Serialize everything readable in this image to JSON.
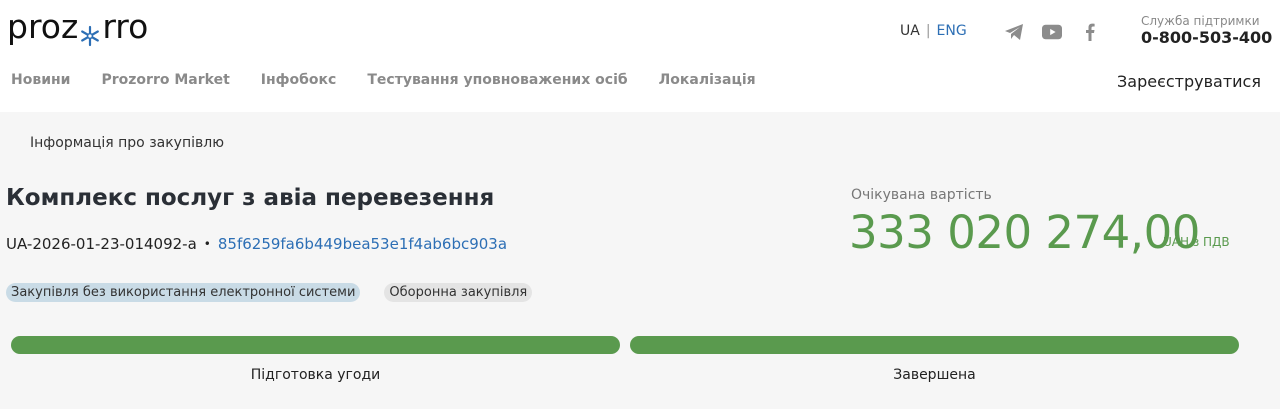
{
  "header": {
    "logo": {
      "left": "proz",
      "right": "rro",
      "alt": "prozorro"
    },
    "lang": {
      "ua": "UA",
      "eng": "ENG"
    },
    "socials": [
      "telegram-icon",
      "youtube-icon",
      "facebook-icon"
    ],
    "support": {
      "label": "Служба підтримки",
      "phone": "0-800-503-400"
    }
  },
  "nav": {
    "items": [
      "Новини",
      "Prozorro Market",
      "Інфобокс",
      "Тестування уповноважених осіб",
      "Локалізація"
    ],
    "register": "Зареєструватися"
  },
  "main": {
    "breadcrumb": "Інформація про закупівлю",
    "title": "Комплекс послуг з авіа перевезення",
    "tender_id": "UA-2026-01-23-014092-a",
    "separator": "•",
    "hash": "85f6259fa6b449bea53e1f4ab6bc903a",
    "badges": [
      "Закупівля без використання електронної системи",
      "Оборонна закупівля"
    ],
    "expected": {
      "label": "Очікувана вартість",
      "value": "333 020 274,00",
      "currency": "UAH з ПДВ"
    },
    "stages": [
      {
        "label": "Підготовка угоди",
        "progress": 1.0
      },
      {
        "label": "Завершена",
        "progress": 1.0
      }
    ]
  },
  "colors": {
    "accent_green": "#5a9a4e",
    "link_blue": "#2d6fb5",
    "badge_blue": "#c9dbe6",
    "badge_grey": "#e4e4e4",
    "background": "#f6f6f6"
  }
}
